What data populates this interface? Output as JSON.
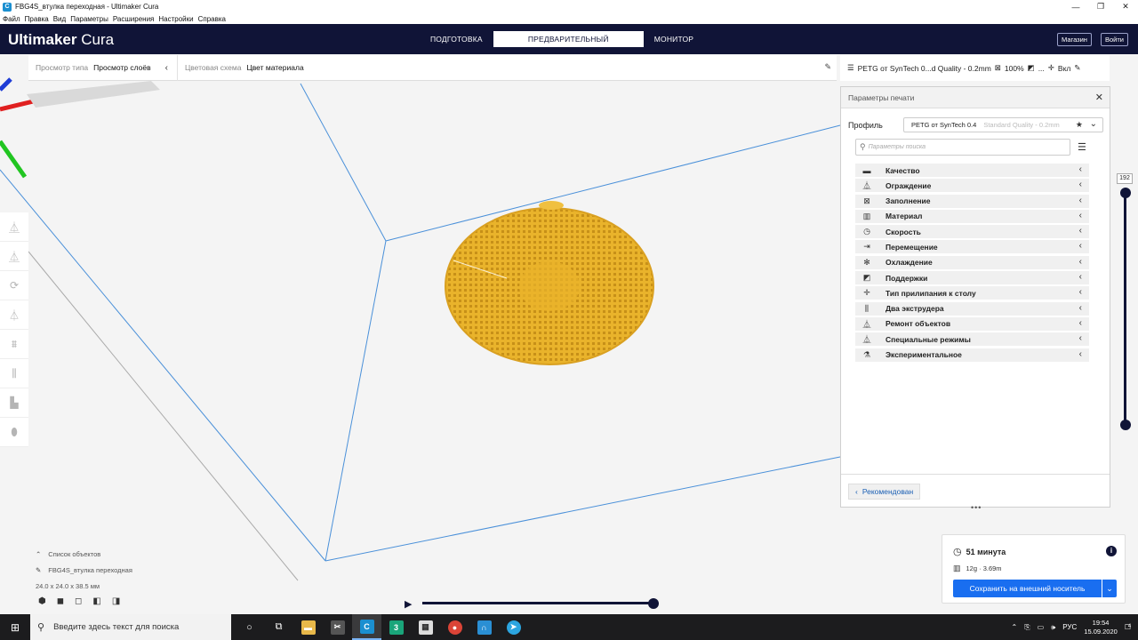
{
  "window": {
    "title": "FBG4S_втулка переходная - Ultimaker Cura",
    "controls": [
      "—",
      "❐",
      "✕"
    ]
  },
  "menu": [
    "Файл",
    "Правка",
    "Вид",
    "Параметры",
    "Расширения",
    "Настройки",
    "Справка"
  ],
  "header": {
    "brand_bold": "Ultimaker",
    "brand_light": "Cura",
    "stages": [
      {
        "label": "ПОДГОТОВКА",
        "active": false
      },
      {
        "label": "ПРЕДВАРИТЕЛЬНЫЙ ПРОСМОТР",
        "active": true
      },
      {
        "label": "МОНИТОР",
        "active": false
      }
    ],
    "marketplace": "Магазин",
    "signin": "Войти"
  },
  "viewbar": {
    "view_type_label": "Просмотр типа",
    "view_type_value": "Просмотр слоёв",
    "color_scheme_label": "Цветовая схема",
    "color_scheme_value": "Цвет материала"
  },
  "printbar": {
    "profile": "PETG от SynTech 0...d Quality - 0.2mm",
    "infill": "100%",
    "support": "...",
    "adhesion": "Вкл"
  },
  "panel": {
    "title": "Параметры печати",
    "profile_label": "Профиль",
    "profile_value": "PETG от SynTech 0.4",
    "profile_quality": "Standard Quality - 0.2mm",
    "search_placeholder": "Параметры поиска",
    "categories": [
      {
        "label": "Качество",
        "icon": "▬"
      },
      {
        "label": "Ограждение",
        "icon": "⏅"
      },
      {
        "label": "Заполнение",
        "icon": "⊠"
      },
      {
        "label": "Материал",
        "icon": "▥"
      },
      {
        "label": "Скорость",
        "icon": "◷"
      },
      {
        "label": "Перемещение",
        "icon": "⇥"
      },
      {
        "label": "Охлаждение",
        "icon": "✻"
      },
      {
        "label": "Поддержки",
        "icon": "◩"
      },
      {
        "label": "Тип прилипания к столу",
        "icon": "✛"
      },
      {
        "label": "Два экструдера",
        "icon": "⫼"
      },
      {
        "label": "Ремонт объектов",
        "icon": "⏅"
      },
      {
        "label": "Специальные режимы",
        "icon": "⏅"
      },
      {
        "label": "Экспериментальное",
        "icon": "⚗"
      }
    ],
    "recommended": "Рекомендован"
  },
  "layer_slider": {
    "value": "192"
  },
  "objects": {
    "list_label": "Список объектов",
    "name": "FBG4S_втулка переходная",
    "dimensions": "24.0 x 24.0 x 38.5 мм"
  },
  "print_info": {
    "time": "51 минута",
    "material": "12g · 3.69m",
    "save_button": "Сохранить на внешний носитель"
  },
  "taskbar": {
    "search": "Введите здесь текст для поиска",
    "lang": "РУС",
    "time": "19:54",
    "date": "15.09.2020",
    "notifications": "4"
  },
  "colors": {
    "header": "#101437",
    "accent": "#196ef0",
    "model": "#e9b32b"
  }
}
